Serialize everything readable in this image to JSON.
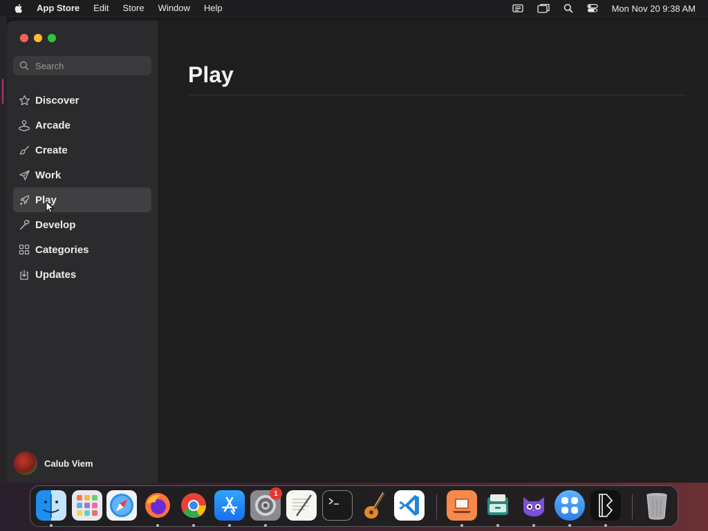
{
  "menubar": {
    "app_name": "App Store",
    "menus": [
      "Edit",
      "Store",
      "Window",
      "Help"
    ],
    "clock": "Mon Nov 20  9:38 AM",
    "status_icons": [
      "display-icon",
      "screen-mirroring-icon",
      "spotlight-icon",
      "control-center-icon"
    ]
  },
  "sidebar": {
    "search_placeholder": "Search",
    "items": [
      {
        "label": "Discover",
        "icon": "star-icon"
      },
      {
        "label": "Arcade",
        "icon": "joystick-icon"
      },
      {
        "label": "Create",
        "icon": "brush-icon"
      },
      {
        "label": "Work",
        "icon": "paper-plane-icon"
      },
      {
        "label": "Play",
        "icon": "rocket-icon",
        "selected": true
      },
      {
        "label": "Develop",
        "icon": "hammer-icon"
      },
      {
        "label": "Categories",
        "icon": "grid-icon"
      },
      {
        "label": "Updates",
        "icon": "download-icon"
      }
    ],
    "user": {
      "name": "Calub Viem"
    }
  },
  "main": {
    "title": "Play"
  },
  "dock": {
    "apps": [
      "Finder",
      "Launchpad",
      "Safari",
      "Firefox",
      "Google Chrome",
      "App Store",
      "System Settings",
      "TextEdit",
      "Terminal",
      "GarageBand",
      "Visual Studio Code",
      "Instruments",
      "Archive Utility",
      "Cat App",
      "Setapp",
      "Bitwarden",
      "Trash"
    ],
    "settings_badge": "1"
  },
  "colors": {
    "selection": "#404042",
    "sidebar_bg": "#2b2b2d",
    "main_bg": "#1e1e1e"
  }
}
